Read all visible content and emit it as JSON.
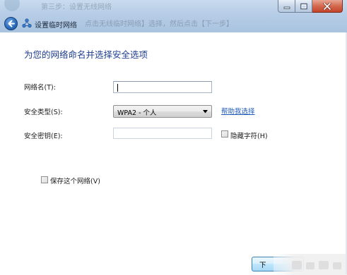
{
  "titlebar": {
    "title": "设置临时网络",
    "ghost_line1": "第三步：设置无线网络",
    "ghost_line2": "点击无线临时网络】选择，然后点击【下一步】",
    "minimize_icon": "minimize-icon",
    "maximize_icon": "maximize-icon",
    "close_icon": "close-icon",
    "back_icon": "back-arrow-icon",
    "network_icon": "network-icon"
  },
  "form": {
    "heading": "为您的网络命名并选择安全选项",
    "network_name_label": "网络名(T):",
    "network_name_value": "",
    "security_type_label": "安全类型(S):",
    "security_type_value": "WPA2 - 个人",
    "help_link": "帮助我选择",
    "security_key_label": "安全密钥(E):",
    "security_key_value": "",
    "hide_chars_label": "隐藏字符(H)",
    "hide_chars_checked": false,
    "save_network_label": "保存这个网络(V)",
    "save_network_checked": false
  },
  "footer": {
    "next_label": "下"
  },
  "colors": {
    "heading": "#1f3f8f",
    "link": "#1e59b8",
    "titlebar": "#b6cde6",
    "close_button": "#c4432a"
  }
}
